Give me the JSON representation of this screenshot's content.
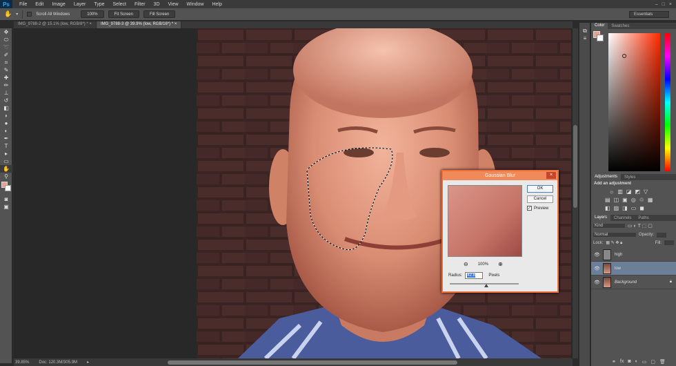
{
  "app": {
    "logo": "Ps"
  },
  "menu": [
    "File",
    "Edit",
    "Image",
    "Layer",
    "Type",
    "Select",
    "Filter",
    "3D",
    "View",
    "Window",
    "Help"
  ],
  "window_controls": [
    "–",
    "□",
    "×"
  ],
  "options_bar": {
    "scroll_all_label": "Scroll All Windows",
    "btn_100": "100%",
    "btn_fit": "Fit Screen",
    "btn_fill": "Fill Screen",
    "workspace": "Essentials"
  },
  "tabs": [
    {
      "label": "IMG_9788-2 @ 15.1% (low, RGB/8*) *",
      "close": "×"
    },
    {
      "label": "IMG_9788-3 @ 39.9% (low, RGB/16*) *",
      "close": "×"
    }
  ],
  "status": {
    "zoom": "39.85%",
    "doc": "Doc: 120.3M/305.9M"
  },
  "panels": {
    "color_tab": "Color",
    "swatches_tab": "Swatches",
    "adjustments_tab": "Adjustments",
    "styles_tab": "Styles",
    "add_adjustment": "Add an adjustment",
    "layers_tab": "Layers",
    "channels_tab": "Channels",
    "paths_tab": "Paths",
    "kind_label": "Kind",
    "blend_mode": "Normal",
    "opacity_label": "Opacity:",
    "lock_label": "Lock:",
    "fill_label": "Fill:",
    "layers": [
      {
        "name": "high",
        "selected": false
      },
      {
        "name": "low",
        "selected": true
      },
      {
        "name": "Background",
        "selected": false
      }
    ]
  },
  "dialog": {
    "title": "Gaussian Blur",
    "close": "×",
    "ok": "OK",
    "cancel": "Cancel",
    "preview_label": "Preview",
    "zoom": "100%",
    "radius_label": "Radius:",
    "radius_value": "42.8",
    "unit": "Pixels"
  },
  "colors": {
    "accent": "#e9703c",
    "foreground_swatch": "#e8a090",
    "selected_layer": "#6b7f96"
  }
}
